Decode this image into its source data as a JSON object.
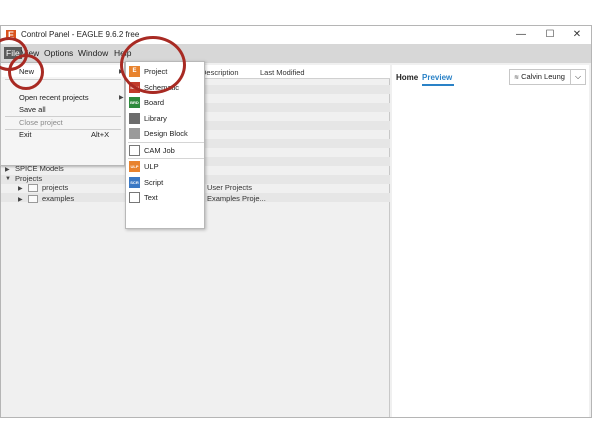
{
  "window": {
    "title": "Control Panel - EAGLE 9.6.2 free",
    "minimize": "—",
    "maximize": "☐",
    "close": "✕",
    "logo": "E"
  },
  "menubar": {
    "file": "File",
    "view": "View",
    "options": "Options",
    "window": "Window",
    "help": "Help"
  },
  "columns": {
    "description": "Description",
    "last_modified": "Last Modified"
  },
  "tree": {
    "spice_models": "SPICE Models",
    "projects": "Projects",
    "projects_folder": "projects",
    "examples_folder": "examples",
    "projects_desc": "User Projects",
    "examples_desc": "Examples Proje..."
  },
  "right_panel": {
    "home_tab": "Home",
    "preview_tab": "Preview",
    "user_name": "Calvin Leung",
    "user_icon": "wifi-icon",
    "dropdown_glyph": "⌵"
  },
  "file_menu": {
    "new": "New",
    "open_recent": "Open recent projects",
    "save_all": "Save all",
    "close_project": "Close project",
    "exit": "Exit",
    "exit_shortcut": "Alt+X"
  },
  "new_submenu": {
    "items": [
      {
        "label": "Project",
        "icon": "project-icon",
        "glyph": "E"
      },
      {
        "label": "Schematic",
        "icon": "schematic-icon",
        "glyph": "SCH"
      },
      {
        "label": "Board",
        "icon": "board-icon",
        "glyph": "BRD"
      },
      {
        "label": "Library",
        "icon": "library-icon",
        "glyph": ""
      },
      {
        "label": "Design Block",
        "icon": "design-block-icon",
        "glyph": ""
      },
      {
        "label": "CAM Job",
        "icon": "cam-job-icon",
        "glyph": ""
      },
      {
        "label": "ULP",
        "icon": "ulp-icon",
        "glyph": "ULP"
      },
      {
        "label": "Script",
        "icon": "script-icon",
        "glyph": "SCR"
      },
      {
        "label": "Text",
        "icon": "text-icon",
        "glyph": ""
      }
    ]
  },
  "colors": {
    "highlight_circle": "#a82a23",
    "preview_accent": "#2a82c7",
    "eagle_orange": "#d9531e"
  }
}
